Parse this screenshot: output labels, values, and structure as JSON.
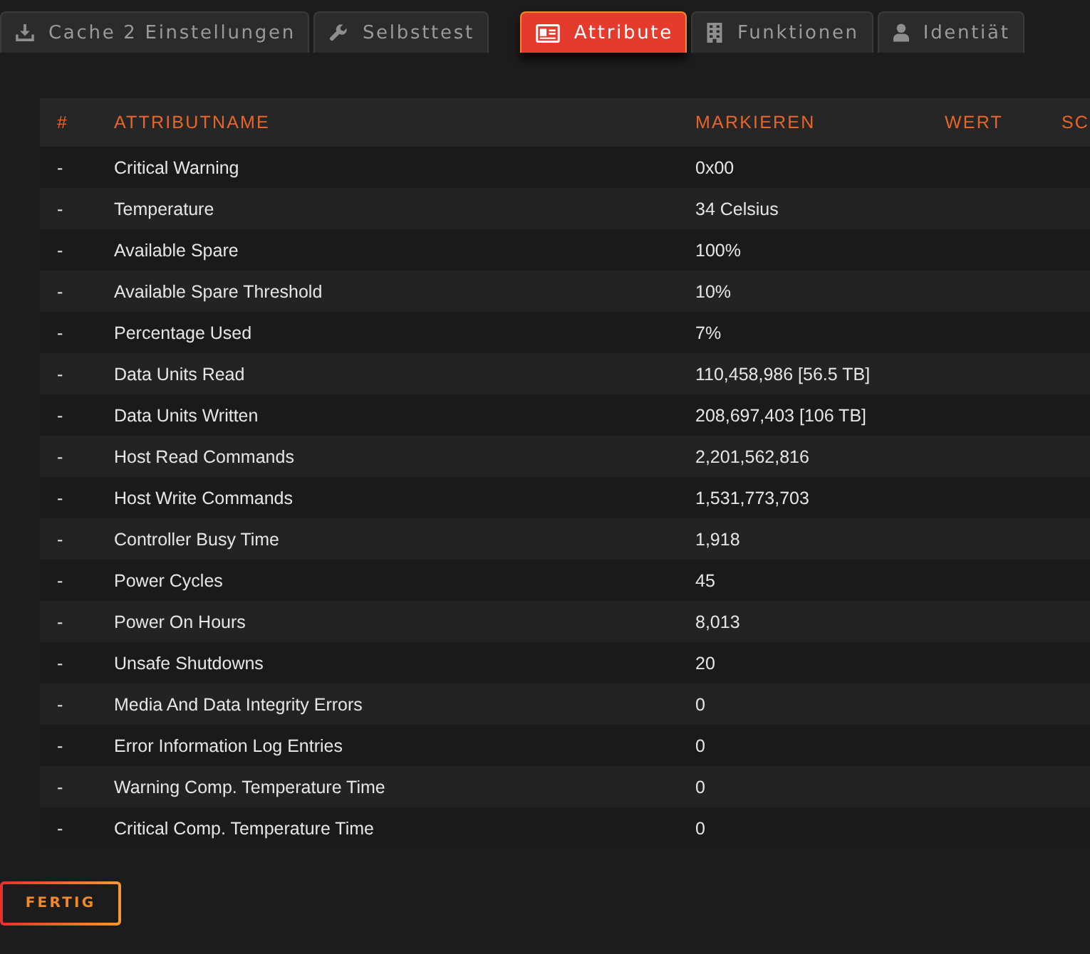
{
  "tab_groups": [
    {
      "tabs": [
        {
          "label": "Cache 2 Einstellungen",
          "selected": false
        },
        {
          "label": "Selbsttest",
          "selected": false
        }
      ]
    },
    {
      "tabs": [
        {
          "label": "Attribute",
          "selected": true
        },
        {
          "label": "Funktionen",
          "selected": false
        },
        {
          "label": "Identiät",
          "selected": false
        }
      ]
    }
  ],
  "table": {
    "columns": [
      "#",
      "ATTRIBUTNAME",
      "MARKIEREN",
      "WERT",
      "SC"
    ],
    "rows": [
      {
        "cells": [
          "-",
          "Critical Warning",
          "0x00"
        ]
      },
      {
        "cells": [
          "-",
          "Temperature",
          "34 Celsius"
        ]
      },
      {
        "cells": [
          "-",
          "Available Spare",
          "100%"
        ]
      },
      {
        "cells": [
          "-",
          "Available Spare Threshold",
          "10%"
        ]
      },
      {
        "cells": [
          "-",
          "Percentage Used",
          "7%"
        ]
      },
      {
        "cells": [
          "-",
          "Data Units Read",
          "110,458,986 [56.5 TB]"
        ]
      },
      {
        "cells": [
          "-",
          "Data Units Written",
          "208,697,403 [106 TB]"
        ]
      },
      {
        "cells": [
          "-",
          "Host Read Commands",
          "2,201,562,816"
        ]
      },
      {
        "cells": [
          "-",
          "Host Write Commands",
          "1,531,773,703"
        ]
      },
      {
        "cells": [
          "-",
          "Controller Busy Time",
          "1,918"
        ]
      },
      {
        "cells": [
          "-",
          "Power Cycles",
          "45"
        ]
      },
      {
        "cells": [
          "-",
          "Power On Hours",
          "8,013"
        ]
      },
      {
        "cells": [
          "-",
          "Unsafe Shutdowns",
          "20"
        ]
      },
      {
        "cells": [
          "-",
          "Media And Data Integrity Errors",
          "0"
        ]
      },
      {
        "cells": [
          "-",
          "Error Information Log Entries",
          "0"
        ]
      },
      {
        "cells": [
          "-",
          "Warning Comp. Temperature Time",
          "0"
        ]
      },
      {
        "cells": [
          "-",
          "Critical Comp. Temperature Time",
          "0"
        ]
      }
    ]
  },
  "done_button": {
    "label": "FERTIG"
  }
}
